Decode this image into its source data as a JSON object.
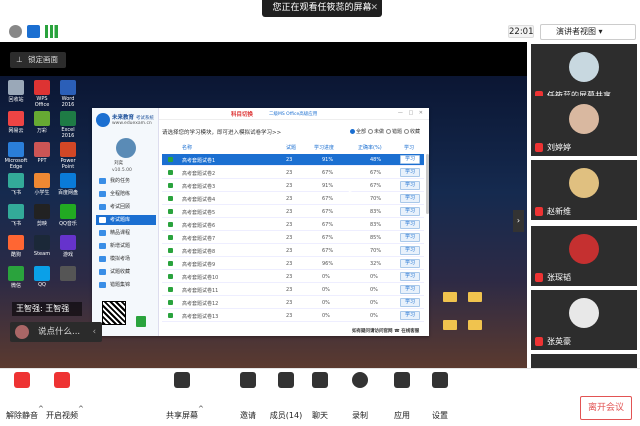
{
  "meeting": {
    "share_banner": "您正在观看任筱蕊的屏幕",
    "clock": "22:01",
    "view_button": "演讲者视图",
    "lock_screen": "锁定画面"
  },
  "desktop_icons": [
    {
      "label": "回收站"
    },
    {
      "label": "WPS Office"
    },
    {
      "label": "Word 2016"
    },
    {
      "label": "网易云"
    },
    {
      "label": "万彩"
    },
    {
      "label": "Excel 2016"
    },
    {
      "label": "Microsoft Edge"
    },
    {
      "label": "PPT"
    },
    {
      "label": "Power Point"
    },
    {
      "label": "飞书"
    },
    {
      "label": "小学生"
    },
    {
      "label": "百度网盘"
    },
    {
      "label": "飞书"
    },
    {
      "label": "剪映"
    },
    {
      "label": "QQ音乐"
    },
    {
      "label": "酷狗"
    },
    {
      "label": "Steam"
    },
    {
      "label": "游戏"
    },
    {
      "label": "微信"
    },
    {
      "label": "QQ"
    },
    {
      "label": ""
    }
  ],
  "app": {
    "brand": "未来教育",
    "brand_tag": "考试系统",
    "site": "www.eduexam.cn",
    "user": "刘奕",
    "version": "v10.5.00",
    "tab_title": "科目切换",
    "tab_subtitle": "二级MS Office高级应用",
    "window_controls": "— □ ✕",
    "prompt": "请选择您的学习模块，即可进入模拟试卷学习>>",
    "filters": [
      {
        "label": "全部",
        "on": true
      },
      {
        "label": "未做",
        "on": false
      },
      {
        "label": "错题",
        "on": false
      },
      {
        "label": "收藏",
        "on": false
      }
    ],
    "menu": [
      {
        "label": "我的任务",
        "active": false
      },
      {
        "label": "全程陪练",
        "active": false
      },
      {
        "label": "考试回顾",
        "active": false
      },
      {
        "label": "考试题库",
        "active": true
      },
      {
        "label": "精品课程",
        "active": false
      },
      {
        "label": "新增试题",
        "active": false
      },
      {
        "label": "模拟考场",
        "active": false
      },
      {
        "label": "试题收藏",
        "active": false
      },
      {
        "label": "错题集锦",
        "active": false
      }
    ],
    "columns": [
      "名称",
      "试题",
      "学习进度",
      "正确率(%)",
      "学习"
    ],
    "rows": [
      {
        "name": "高考套题试卷1",
        "count": "23",
        "progress": "91%",
        "accuracy": "48%",
        "action": "学习"
      },
      {
        "name": "高考套题试卷2",
        "count": "23",
        "progress": "67%",
        "accuracy": "67%",
        "action": "学习"
      },
      {
        "name": "高考套题试卷3",
        "count": "23",
        "progress": "91%",
        "accuracy": "67%",
        "action": "学习"
      },
      {
        "name": "高考套题试卷4",
        "count": "23",
        "progress": "67%",
        "accuracy": "70%",
        "action": "学习"
      },
      {
        "name": "高考套题试卷5",
        "count": "23",
        "progress": "67%",
        "accuracy": "83%",
        "action": "学习"
      },
      {
        "name": "高考套题试卷6",
        "count": "23",
        "progress": "67%",
        "accuracy": "83%",
        "action": "学习"
      },
      {
        "name": "高考套题试卷7",
        "count": "23",
        "progress": "67%",
        "accuracy": "85%",
        "action": "学习"
      },
      {
        "name": "高考套题试卷8",
        "count": "23",
        "progress": "67%",
        "accuracy": "70%",
        "action": "学习"
      },
      {
        "name": "高考套题试卷9",
        "count": "23",
        "progress": "96%",
        "accuracy": "32%",
        "action": "学习"
      },
      {
        "name": "高考套题试卷10",
        "count": "23",
        "progress": "0%",
        "accuracy": "0%",
        "action": "学习"
      },
      {
        "name": "高考套题试卷11",
        "count": "23",
        "progress": "0%",
        "accuracy": "0%",
        "action": "学习"
      },
      {
        "name": "高考套题试卷12",
        "count": "23",
        "progress": "0%",
        "accuracy": "0%",
        "action": "学习"
      },
      {
        "name": "高考套题试卷13",
        "count": "23",
        "progress": "0%",
        "accuracy": "0%",
        "action": "学习"
      }
    ],
    "footer": "如有疑问请访问官网 ☎ 在线客服"
  },
  "overlay": {
    "task_name": "王智强: 王智强",
    "chat_preview": "说点什么..."
  },
  "participants": [
    {
      "name": "任筱蕊的屏幕共享",
      "face_color": "#c8d8e0"
    },
    {
      "name": "刘婷婷",
      "face_color": "#d9b8a0"
    },
    {
      "name": "赵新维",
      "face_color": "#e0c080"
    },
    {
      "name": "张琛韬",
      "face_color": "#c53030"
    },
    {
      "name": "张英豪",
      "face_color": "#e8e8e8"
    },
    {
      "name": "",
      "face_color": "#6c4"
    }
  ],
  "toolbar": [
    {
      "label": "解除静音"
    },
    {
      "label": "开启视频"
    },
    {
      "label": "共享屏幕"
    },
    {
      "label": "邀请"
    },
    {
      "label": "成员(14)"
    },
    {
      "label": "聊天"
    },
    {
      "label": "录制"
    },
    {
      "label": "应用"
    },
    {
      "label": "设置"
    }
  ],
  "leave_button": "离开会议",
  "colors": {
    "accent": "#1b6fd1",
    "leave": "#e25353",
    "success": "#2aa33d"
  }
}
